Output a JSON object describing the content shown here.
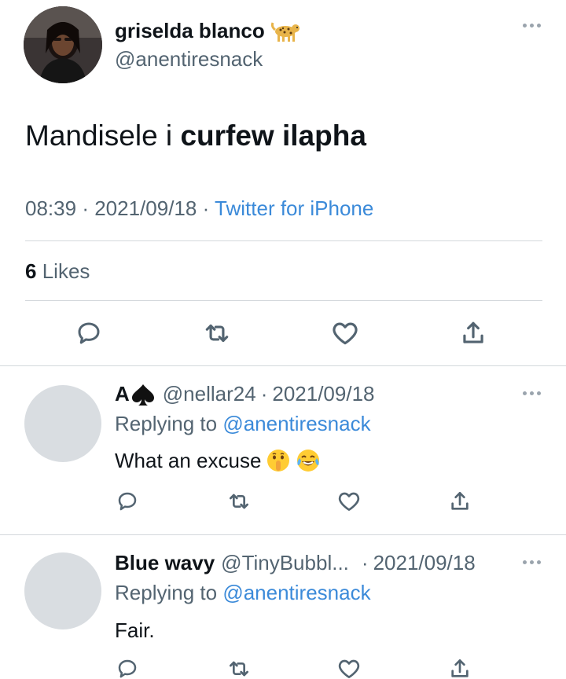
{
  "main_tweet": {
    "display_name": "griselda blanco",
    "name_emoji": "leopard",
    "handle": "@anentiresnack",
    "text_plain": "Mandisele i ",
    "text_bold": "curfew ilapha",
    "time": "08:39",
    "date": "2021/09/18",
    "separator": "·",
    "source": "Twitter for iPhone",
    "likes_count": "6",
    "likes_label": "Likes"
  },
  "replies": [
    {
      "display_name": "A",
      "name_emoji": "spade",
      "handle": "@nellar24",
      "separator": "·",
      "date": "2021/09/18",
      "replying_label": "Replying to",
      "replying_to": "@anentiresnack",
      "text": "What an excuse",
      "emojis": [
        "shushing-face",
        "tears-of-joy-face"
      ]
    },
    {
      "display_name": "Blue wavy",
      "handle": "@TinyBubbl...",
      "separator": "·",
      "date": "2021/09/18",
      "replying_label": "Replying to",
      "replying_to": "@anentiresnack",
      "text": "Fair."
    }
  ],
  "colors": {
    "text": "#0f1419",
    "secondary": "#536471",
    "link": "#3b8ad9",
    "divider": "#d3d8dc",
    "placeholder_avatar": "#d9dde1"
  },
  "icons": [
    "reply-icon",
    "retweet-icon",
    "like-icon",
    "share-icon",
    "more-icon"
  ]
}
